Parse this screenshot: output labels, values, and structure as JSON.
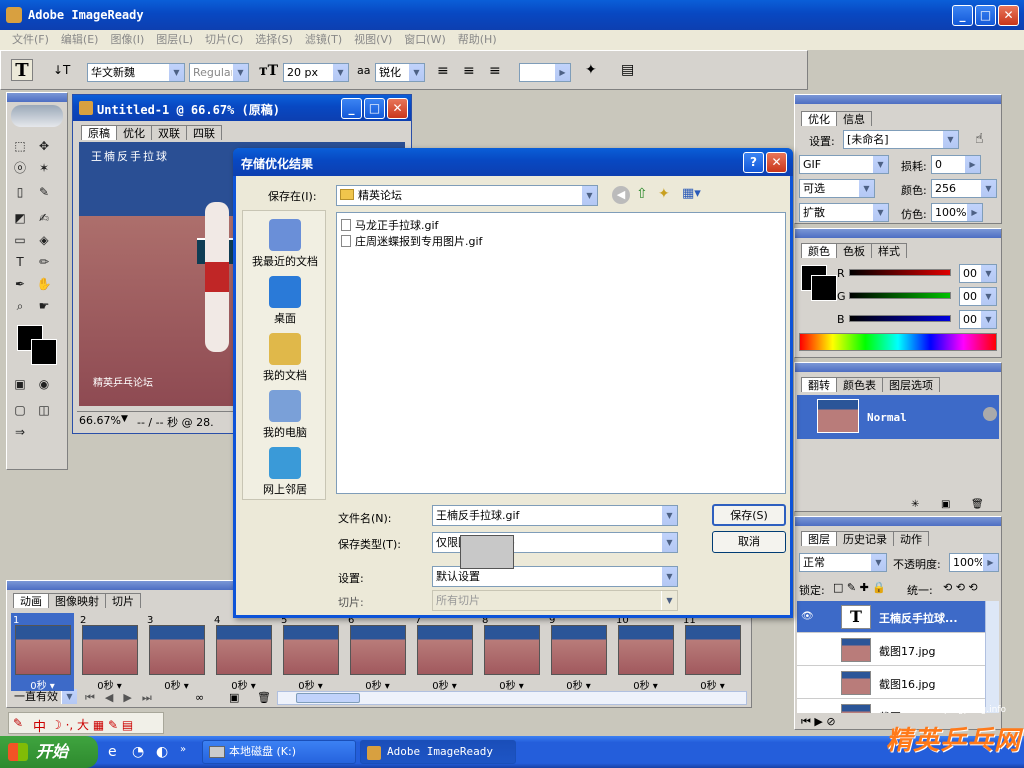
{
  "app": {
    "title": "Adobe ImageReady"
  },
  "menu": [
    "文件(F)",
    "编辑(E)",
    "图像(I)",
    "图层(L)",
    "切片(C)",
    "选择(S)",
    "滤镜(T)",
    "视图(V)",
    "窗口(W)",
    "帮助(H)"
  ],
  "options_bar": {
    "font_family": "华文新魏",
    "font_style": "Regular",
    "font_size": "20 px",
    "aa_label": "a",
    "antialias": "锐化",
    "tracking": ""
  },
  "doc": {
    "title": "Untitled-1 @ 66.67% (原稿)",
    "tabs": [
      "原稿",
      "优化",
      "双联",
      "四联"
    ],
    "overlay_text": "王楠反手拉球",
    "watermark": "精英乒乓论坛",
    "status_zoom": "66.67%",
    "status_info": "-- / -- 秒 @ 28."
  },
  "dialog": {
    "title": "存储优化结果",
    "save_in_label": "保存在(I):",
    "save_in_value": "精英论坛",
    "places": [
      "我最近的文档",
      "桌面",
      "我的文档",
      "我的电脑",
      "网上邻居"
    ],
    "files": [
      "马龙正手拉球.gif",
      "庄周迷蝶报到专用图片.gif"
    ],
    "filename_label": "文件名(N):",
    "filename_value": "王楠反手拉球.gif",
    "type_label": "保存类型(T):",
    "type_value": "仅限图像 (*.gif)",
    "settings_label": "设置:",
    "settings_value": "默认设置",
    "slices_label": "切片:",
    "slices_value": "所有切片",
    "save_button": "保存(S)",
    "cancel_button": "取消"
  },
  "optimize": {
    "tabs": [
      "优化",
      "信息"
    ],
    "settings_label": "设置:",
    "settings_value": "[未命名]",
    "format": "GIF",
    "lossy_label": "损耗:",
    "lossy_value": "0",
    "palette": "可选",
    "colors_label": "颜色:",
    "colors_value": "256",
    "dither": "扩散",
    "dither_label": "仿色:",
    "dither_value": "100%"
  },
  "color": {
    "tabs": [
      "颜色",
      "色板",
      "样式"
    ],
    "channels": [
      {
        "label": "R",
        "value": "00",
        "color": "#e00000"
      },
      {
        "label": "G",
        "value": "00",
        "color": "#00c000"
      },
      {
        "label": "B",
        "value": "00",
        "color": "#0000e0"
      }
    ]
  },
  "rollover": {
    "tabs": [
      "翻转",
      "颜色表",
      "图层选项"
    ],
    "state": "Normal"
  },
  "layers": {
    "tabs": [
      "图层",
      "历史记录",
      "动作"
    ],
    "blend": "正常",
    "opacity_label": "不透明度:",
    "opacity_value": "100%",
    "lock_label": "锁定:",
    "unify_label": "统一:",
    "items": [
      "王楠反手拉球...",
      "截图17.jpg",
      "截图16.jpg",
      "截图1..."
    ]
  },
  "animation": {
    "tabs": [
      "动画",
      "图像映射",
      "切片"
    ],
    "frames": [
      "1",
      "2",
      "3",
      "4",
      "5",
      "6",
      "7",
      "8",
      "9",
      "10",
      "11"
    ],
    "frame_time": "0秒",
    "loop": "一直有效"
  },
  "ime": {
    "text": "中"
  },
  "taskbar": {
    "start": "开始",
    "tasks": [
      "本地磁盘 (K:)",
      "Adobe ImageReady"
    ],
    "site_mark": "pingpang.info",
    "logo_text": "精英乒乓网"
  }
}
